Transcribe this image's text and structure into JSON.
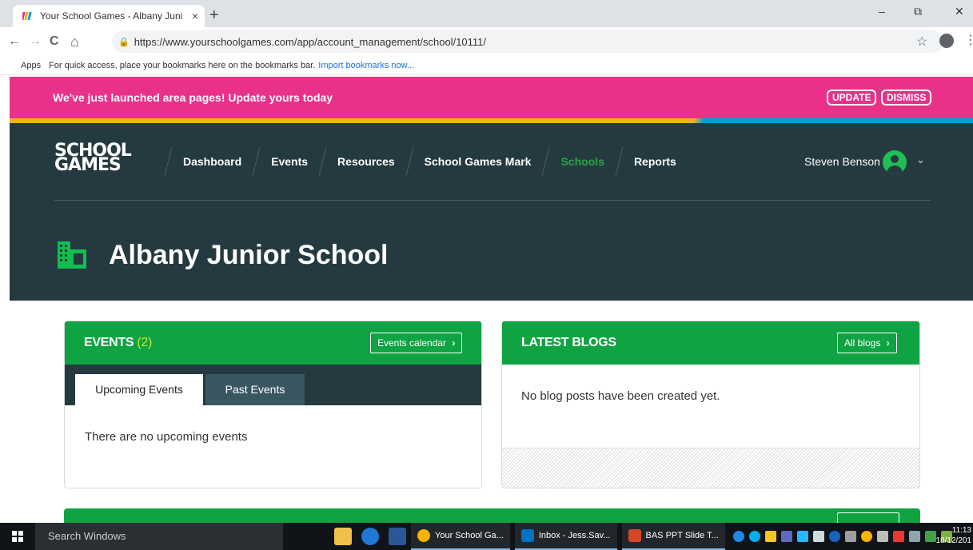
{
  "browser": {
    "tab_title": "Your School Games - Albany Juni",
    "tab_close": "×",
    "new_tab": "+",
    "url": "https://www.yourschoolgames.com/app/account_management/school/10111/",
    "bookmarks": {
      "apps": "Apps",
      "hint": "For quick access, place your bookmarks here on the bookmarks bar.",
      "import_link": "Import bookmarks now..."
    },
    "window_controls": {
      "minimize": "–",
      "restore": "⧉",
      "close": "✕"
    },
    "nav": {
      "back": "←",
      "forward": "→",
      "reload": "C",
      "home": "⌂",
      "star": "☆",
      "menu": "⋮"
    }
  },
  "banner": {
    "message": "We've just launched area pages! Update yours today",
    "update_label": "UPDATE",
    "dismiss_label": "DISMISS"
  },
  "header": {
    "logo": {
      "line1": "SCHOOL",
      "line2": "GAMES"
    },
    "nav": [
      "Dashboard",
      "Events",
      "Resources",
      "School Games Mark",
      "Schools",
      "Reports"
    ],
    "active_nav": "Schools",
    "user_name": "Steven Benson",
    "chevron": "⌄",
    "page_title": "Albany Junior School"
  },
  "events_card": {
    "title": "EVENTS",
    "count": "(2)",
    "button_label": "Events calendar",
    "tabs": [
      "Upcoming Events",
      "Past Events"
    ],
    "empty_text": "There are no upcoming events"
  },
  "blogs_card": {
    "title": "LATEST BLOGS",
    "button_label": "All blogs",
    "empty_text": "No blog posts have been created yet."
  },
  "arrow": "›",
  "taskbar": {
    "search_placeholder": "Search Windows",
    "apps": [
      "Your School Ga...",
      "Inbox - Jess.Sav...",
      "BAS PPT Slide T..."
    ],
    "time": "11:13",
    "date": "18/12/201"
  },
  "colors": {
    "banner": "#e9318a",
    "header": "#253a40",
    "accent_green": "#0fa344",
    "active_nav": "#23a843"
  }
}
